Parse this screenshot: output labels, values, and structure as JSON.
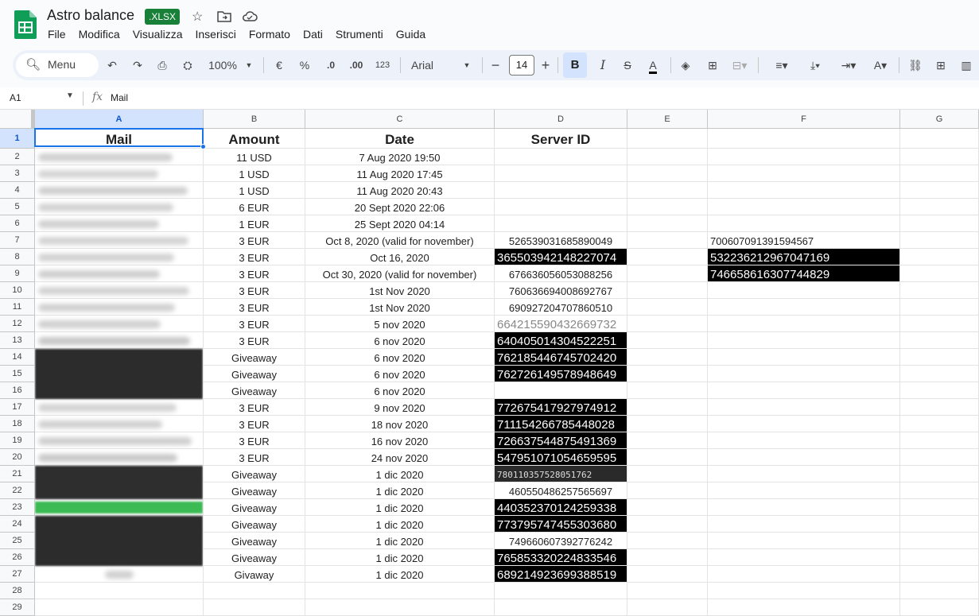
{
  "app": {
    "title": "Astro balance",
    "badge": ".XLSX"
  },
  "menu": [
    "File",
    "Modifica",
    "Visualizza",
    "Inserisci",
    "Formato",
    "Dati",
    "Strumenti",
    "Guida"
  ],
  "toolbar": {
    "search_label": "Menu",
    "zoom": "100%",
    "currency": "€",
    "percent": "%",
    "dec_less": ".0",
    "dec_more": ".00",
    "num_format": "123",
    "font": "Arial",
    "font_size": "14",
    "bold": "B",
    "italic": "I"
  },
  "formula_bar": {
    "cell_ref": "A1",
    "fx": "fx",
    "value": "Mail"
  },
  "columns": [
    "A",
    "B",
    "C",
    "D",
    "E",
    "F",
    "G"
  ],
  "rows": [
    {
      "n": "1",
      "a": "Mail",
      "b": "Amount",
      "c": "Date",
      "d": "Server ID",
      "f": ""
    },
    {
      "n": "2",
      "a": "",
      "b": "11 USD",
      "c": "7 Aug 2020 19:50",
      "d": "",
      "f": ""
    },
    {
      "n": "3",
      "a": "",
      "b": "1 USD",
      "c": "11 Aug 2020 17:45",
      "d": "",
      "f": ""
    },
    {
      "n": "4",
      "a": "",
      "b": "1 USD",
      "c": "11 Aug 2020 20:43",
      "d": "",
      "f": ""
    },
    {
      "n": "5",
      "a": "",
      "b": "6 EUR",
      "c": "20 Sept 2020 22:06",
      "d": "",
      "f": ""
    },
    {
      "n": "6",
      "a": "",
      "b": "1 EUR",
      "c": "25 Sept 2020 04:14",
      "d": "",
      "f": ""
    },
    {
      "n": "7",
      "a": "",
      "b": "3 EUR",
      "c": "Oct 8, 2020 (valid for november)",
      "d": "526539031685890049",
      "f": "700607091391594567"
    },
    {
      "n": "8",
      "a": "",
      "b": "3 EUR",
      "c": "Oct 16, 2020",
      "d": "365503942148227074",
      "f": "532236212967047169"
    },
    {
      "n": "9",
      "a": "",
      "b": "3 EUR",
      "c": "Oct 30, 2020 (valid for november)",
      "d": "676636056053088256",
      "f": "746658616307744829"
    },
    {
      "n": "10",
      "a": "",
      "b": "3 EUR",
      "c": "1st Nov 2020",
      "d": "760636694008692767",
      "f": ""
    },
    {
      "n": "11",
      "a": "",
      "b": "3 EUR",
      "c": "1st Nov 2020",
      "d": "690927204707860510",
      "f": ""
    },
    {
      "n": "12",
      "a": "",
      "b": "3 EUR",
      "c": "5 nov 2020",
      "d": "664215590432669732",
      "f": ""
    },
    {
      "n": "13",
      "a": "",
      "b": "3 EUR",
      "c": "6 nov 2020",
      "d": "640405014304522251",
      "f": ""
    },
    {
      "n": "14",
      "a": "",
      "b": "Giveaway",
      "c": "6 nov 2020",
      "d": "762185446745702420",
      "f": ""
    },
    {
      "n": "15",
      "a": "",
      "b": "Giveaway",
      "c": "6 nov 2020",
      "d": "762726149578948649",
      "f": ""
    },
    {
      "n": "16",
      "a": "",
      "b": "Giveaway",
      "c": "6 nov 2020",
      "d": "",
      "f": ""
    },
    {
      "n": "17",
      "a": "",
      "b": "3 EUR",
      "c": "9 nov 2020",
      "d": "772675417927974912",
      "f": ""
    },
    {
      "n": "18",
      "a": "",
      "b": "3 EUR",
      "c": "18 nov 2020",
      "d": "711154266785448028",
      "f": ""
    },
    {
      "n": "19",
      "a": "",
      "b": "3 EUR",
      "c": "16 nov 2020",
      "d": "726637544875491369",
      "f": ""
    },
    {
      "n": "20",
      "a": "",
      "b": "3 EUR",
      "c": "24 nov 2020",
      "d": "547951071054659595",
      "f": ""
    },
    {
      "n": "21",
      "a": "",
      "b": "Giveaway",
      "c": "1 dic 2020",
      "d": "780110357528051762",
      "f": ""
    },
    {
      "n": "22",
      "a": "",
      "b": "Giveaway",
      "c": "1 dic 2020",
      "d": "460550486257565697",
      "f": ""
    },
    {
      "n": "23",
      "a": "",
      "b": "Giveaway",
      "c": "1 dic 2020",
      "d": "440352370124259338",
      "f": ""
    },
    {
      "n": "24",
      "a": "",
      "b": "Giveaway",
      "c": "1 dic 2020",
      "d": "773795747455303680",
      "f": ""
    },
    {
      "n": "25",
      "a": "",
      "b": "Giveaway",
      "c": "1 dic 2020",
      "d": "749660607392776242",
      "f": ""
    },
    {
      "n": "26",
      "a": "",
      "b": "Giveaway",
      "c": "1 dic 2020",
      "d": "765853320224833546",
      "f": ""
    },
    {
      "n": "27",
      "a": "",
      "b": "Givaway",
      "c": "1 dic 2020",
      "d": "689214923699388519",
      "f": ""
    },
    {
      "n": "28",
      "a": "",
      "b": "",
      "c": "",
      "d": "",
      "f": ""
    },
    {
      "n": "29",
      "a": "",
      "b": "",
      "c": "",
      "d": "",
      "f": ""
    }
  ],
  "colors": {
    "accent": "#1a73e8",
    "sheets_green": "#188038",
    "toolbar_bg": "#edf2fa",
    "highlight_black": "#000000"
  }
}
